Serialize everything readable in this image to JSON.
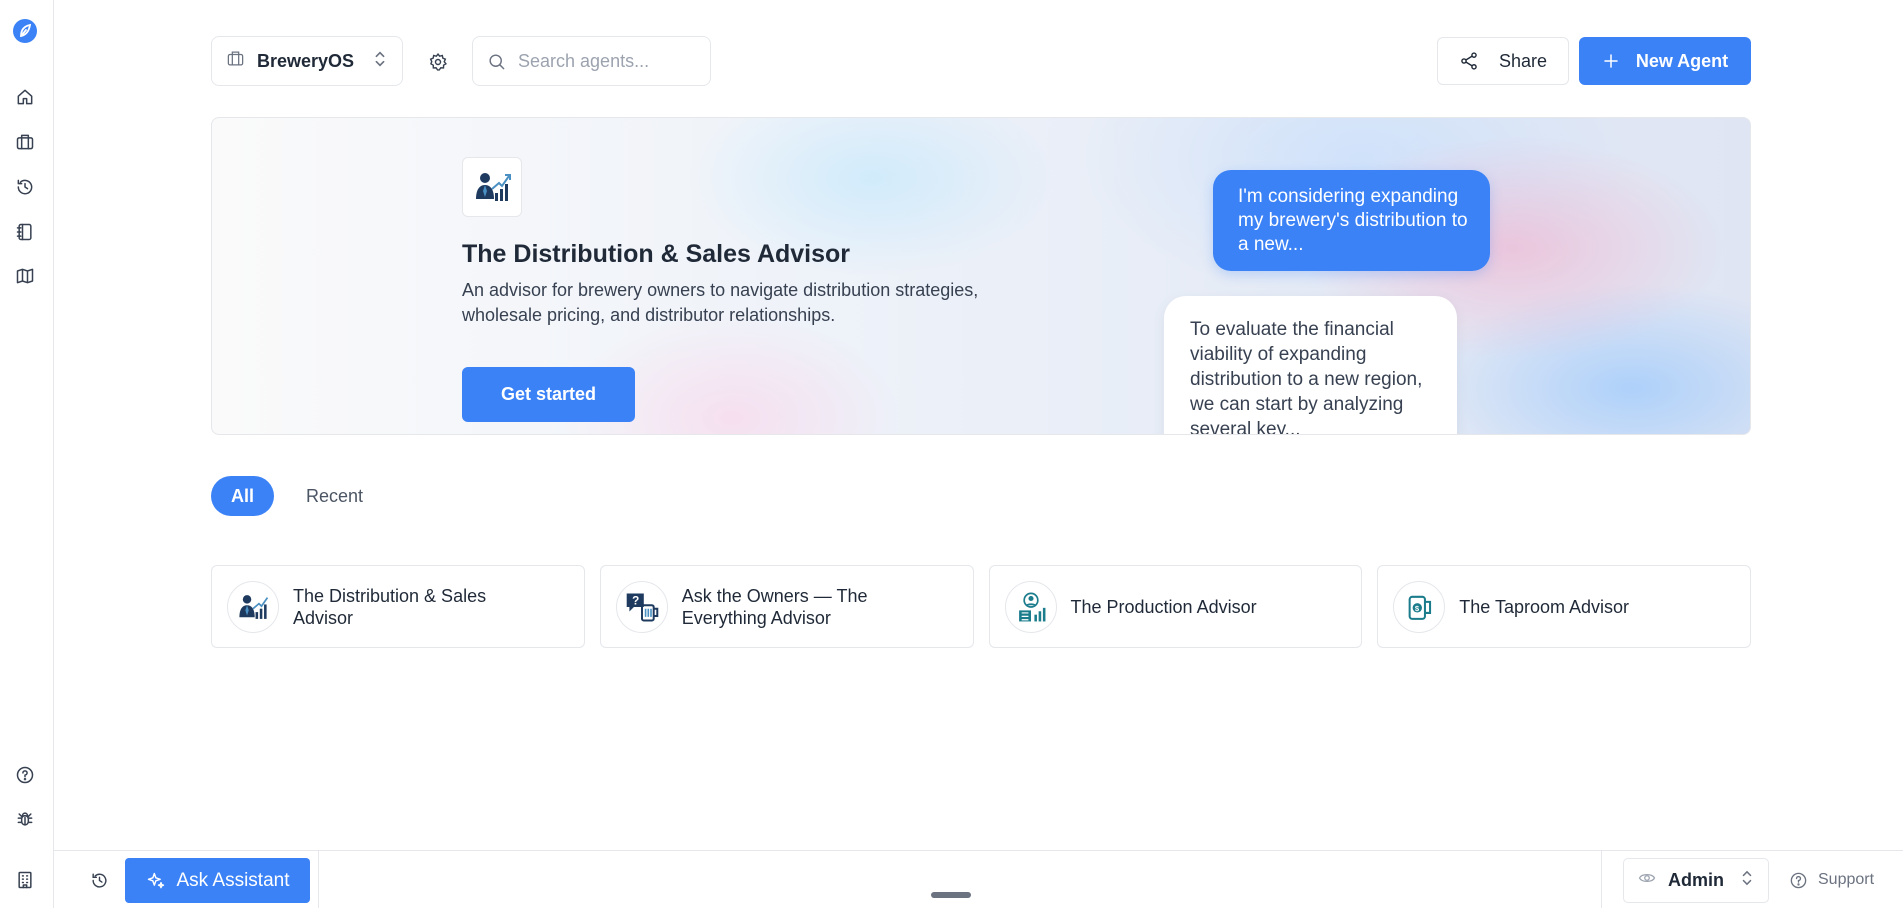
{
  "app": {
    "brand_color": "#3b82f6"
  },
  "rail": {
    "items": [
      {
        "icon": "home-icon"
      },
      {
        "icon": "briefcase-icon"
      },
      {
        "icon": "history-icon"
      },
      {
        "icon": "notebook-icon"
      },
      {
        "icon": "map-icon"
      }
    ],
    "bottom_items": [
      {
        "icon": "help-icon"
      },
      {
        "icon": "bug-icon"
      },
      {
        "icon": "building-icon"
      }
    ]
  },
  "toolbar": {
    "workspace_label": "BreweryOS",
    "search_placeholder": "Search agents...",
    "share_label": "Share",
    "new_agent_label": "New Agent"
  },
  "hero": {
    "title": "The Distribution & Sales Advisor",
    "description": "An advisor for brewery owners to navigate distribution strategies, wholesale pricing, and distributor relationships.",
    "cta_label": "Get started",
    "user_message": "I'm considering expanding my brewery's distribution to a new...",
    "assistant_message": "To evaluate the financial viability of expanding distribution to a new region, we can start by analyzing several key..."
  },
  "tabs": [
    {
      "label": "All",
      "active": true
    },
    {
      "label": "Recent",
      "active": false
    }
  ],
  "agents": [
    {
      "name": "The Distribution & Sales Advisor",
      "icon": "sales-chart-person-icon"
    },
    {
      "name": "Ask the Owners — The Everything Advisor",
      "icon": "question-beer-icon"
    },
    {
      "name": "The Production Advisor",
      "icon": "production-person-icon"
    },
    {
      "name": "The Taproom Advisor",
      "icon": "beer-mug-icon"
    }
  ],
  "bottom_bar": {
    "ask_label": "Ask Assistant",
    "role_label": "Admin",
    "support_label": "Support"
  }
}
